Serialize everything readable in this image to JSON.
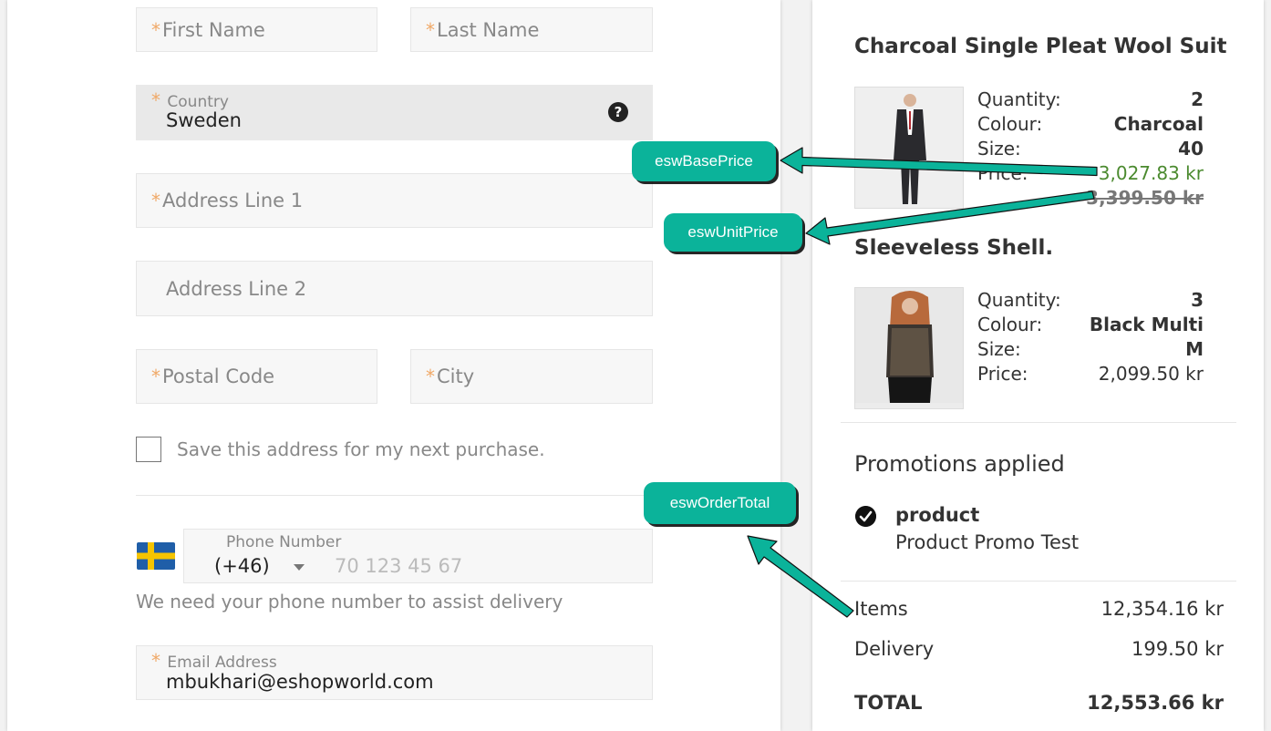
{
  "form": {
    "first_name_placeholder": "First Name",
    "last_name_placeholder": "Last Name",
    "country_label": "Country",
    "country_value": "Sweden",
    "address1_placeholder": "Address Line 1",
    "address2_placeholder": "Address Line 2",
    "postal_placeholder": "Postal Code",
    "city_placeholder": "City",
    "save_address_label": "Save this address for my next purchase.",
    "phone_label": "Phone Number",
    "phone_code": "(+46)",
    "phone_placeholder": "70 123 45 67",
    "phone_hint": "We need your phone number to assist delivery",
    "email_label": "Email Address",
    "email_value": "mbukhari@eshopworld.com",
    "required_mark": "*",
    "help_icon_glyph": "?"
  },
  "products": [
    {
      "title": "Charcoal Single Pleat Wool Suit",
      "quantity_label": "Quantity:",
      "quantity": "2",
      "colour_label": "Colour:",
      "colour": "Charcoal",
      "size_label": "Size:",
      "size": "40",
      "price_label": "Price:",
      "price": "3,027.83 kr",
      "original_price": "3,399.50 kr"
    },
    {
      "title": "Sleeveless Shell.",
      "quantity_label": "Quantity:",
      "quantity": "3",
      "colour_label": "Colour:",
      "colour": "Black Multi",
      "size_label": "Size:",
      "size": "M",
      "price_label": "Price:",
      "price": "2,099.50 kr"
    }
  ],
  "promotions": {
    "heading": "Promotions applied",
    "items": [
      {
        "name": "product",
        "description": "Product Promo Test"
      }
    ]
  },
  "summary": {
    "items_label": "Items",
    "items_value": "12,354.16 kr",
    "delivery_label": "Delivery",
    "delivery_value": "199.50 kr",
    "total_label": "TOTAL",
    "total_value": "12,553.66 kr"
  },
  "callouts": {
    "base_price": "eswBasePrice",
    "unit_price": "eswUnitPrice",
    "order_total": "eswOrderTotal"
  },
  "colors": {
    "accent_green": "#0bb39a",
    "price_green": "#4b8a2f",
    "required_orange": "#f0a866"
  }
}
